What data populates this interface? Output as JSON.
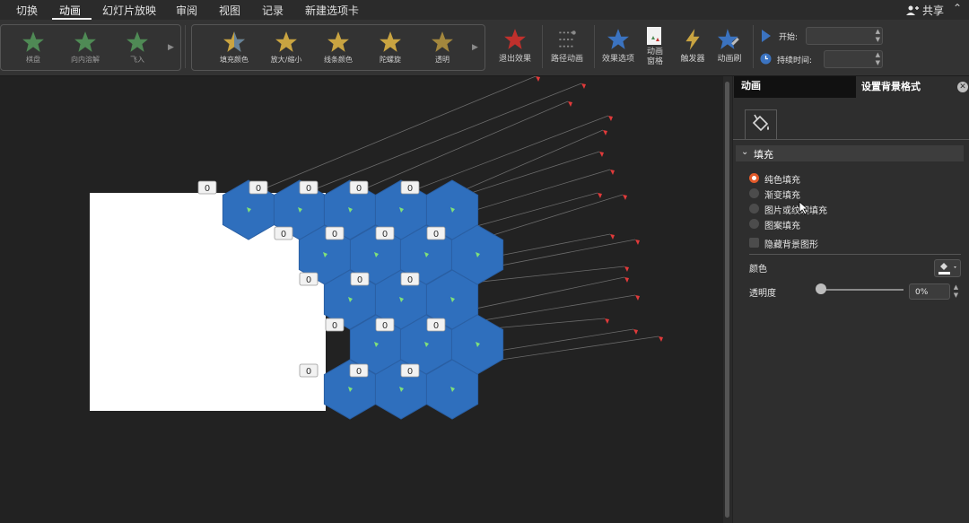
{
  "menu": {
    "tabs": [
      "切换",
      "动画",
      "幻灯片放映",
      "审阅",
      "视图",
      "记录",
      "新建选项卡"
    ],
    "active": "动画",
    "share": "共享"
  },
  "ribbon": {
    "entrance_group": [
      "棋盘",
      "向内溶解",
      "飞入"
    ],
    "emphasis_group": [
      "填充颜色",
      "放大/缩小",
      "线条颜色",
      "陀螺旋",
      "透明"
    ],
    "exit_effects": "退出效果",
    "path_animation": "路径动画",
    "effect_options": "效果选项",
    "animation_pane_line1": "动画",
    "animation_pane_line2": "窗格",
    "trigger": "触发器",
    "animation_painter": "动画刷",
    "start_label": "开始:",
    "duration_label": "持续时间:",
    "start_value": "",
    "duration_value": "",
    "colors": {
      "entrance_star": "#4f8a55",
      "emphasis_star": "#c9a441",
      "exit_star": "#c0302c",
      "effect_star": "#3b73c0"
    }
  },
  "slide": {
    "badge_value": "0",
    "hex_color": "#2f6fbd",
    "tag_color": "#e03a3a"
  },
  "pane": {
    "tab_animation": "动画",
    "tab_format": "设置背景格式",
    "section": "填充",
    "options": [
      "纯色填充",
      "渐变填充",
      "图片或纹理填充",
      "图案填充"
    ],
    "selected": "纯色填充",
    "hide_bg": "隐藏背景图形",
    "color_label": "颜色",
    "transparency_label": "透明度",
    "transparency_value": "0%",
    "accent": "#e25a2a"
  }
}
